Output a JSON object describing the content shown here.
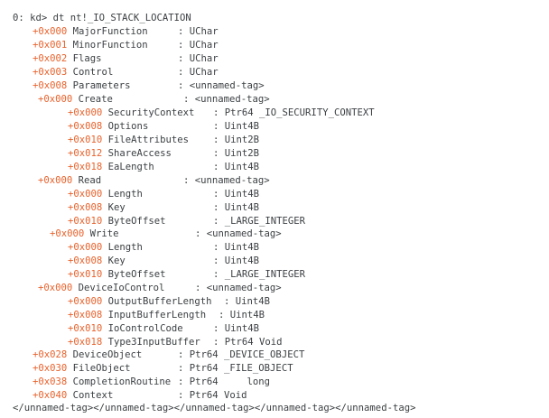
{
  "command_line": "0: kd> dt nt!_IO_STACK_LOCATION",
  "rows": [
    {
      "offset": "+0x000",
      "field": "MajorFunction",
      "type": "UChar"
    },
    {
      "offset": "+0x001",
      "field": "MinorFunction",
      "type": "UChar"
    },
    {
      "offset": "+0x002",
      "field": "Flags",
      "type": "UChar"
    },
    {
      "offset": "+0x003",
      "field": "Control",
      "type": "UChar"
    },
    {
      "offset": "+0x008",
      "field": "Parameters",
      "type": "<unnamed-tag>"
    },
    {
      "offset": "+0x000",
      "field": "Create",
      "type": "<unnamed-tag>"
    },
    {
      "offset": "+0x000",
      "field": "SecurityContext",
      "type": "Ptr64 _IO_SECURITY_CONTEXT"
    },
    {
      "offset": "+0x008",
      "field": "Options",
      "type": "Uint4B"
    },
    {
      "offset": "+0x010",
      "field": "FileAttributes",
      "type": "Uint2B"
    },
    {
      "offset": "+0x012",
      "field": "ShareAccess",
      "type": "Uint2B"
    },
    {
      "offset": "+0x018",
      "field": "EaLength",
      "type": "Uint4B"
    },
    {
      "offset": "+0x000",
      "field": "Read",
      "type": "<unnamed-tag>"
    },
    {
      "offset": "+0x000",
      "field": "Length",
      "type": "Uint4B"
    },
    {
      "offset": "+0x008",
      "field": "Key",
      "type": "Uint4B"
    },
    {
      "offset": "+0x010",
      "field": "ByteOffset",
      "type": "_LARGE_INTEGER"
    },
    {
      "offset": "+0x000",
      "field": "Write",
      "type": "<unnamed-tag>"
    },
    {
      "offset": "+0x000",
      "field": "Length",
      "type": "Uint4B"
    },
    {
      "offset": "+0x008",
      "field": "Key",
      "type": "Uint4B"
    },
    {
      "offset": "+0x010",
      "field": "ByteOffset",
      "type": "_LARGE_INTEGER"
    },
    {
      "offset": "+0x000",
      "field": "DeviceIoControl",
      "type": "<unnamed-tag>"
    },
    {
      "offset": "+0x000",
      "field": "OutputBufferLength",
      "type": "Uint4B"
    },
    {
      "offset": "+0x008",
      "field": "InputBufferLength",
      "type": "Uint4B"
    },
    {
      "offset": "+0x010",
      "field": "IoControlCode",
      "type": "Uint4B"
    },
    {
      "offset": "+0x018",
      "field": "Type3InputBuffer",
      "type": "Ptr64 Void"
    },
    {
      "offset": "+0x028",
      "field": "DeviceObject",
      "type": "Ptr64 _DEVICE_OBJECT"
    },
    {
      "offset": "+0x030",
      "field": "FileObject",
      "type": "Ptr64 _FILE_OBJECT"
    },
    {
      "offset": "+0x038",
      "field": "CompletionRoutine",
      "type": "Ptr64     long"
    },
    {
      "offset": "+0x040",
      "field": "Context",
      "type": "Ptr64 Void"
    }
  ],
  "closing_line": "</unnamed-tag></unnamed-tag></unnamed-tag></unnamed-tag></unnamed-tag>",
  "colors": {
    "offset": "#e8622c",
    "text": "#3c4043",
    "background": "#ffffff"
  }
}
